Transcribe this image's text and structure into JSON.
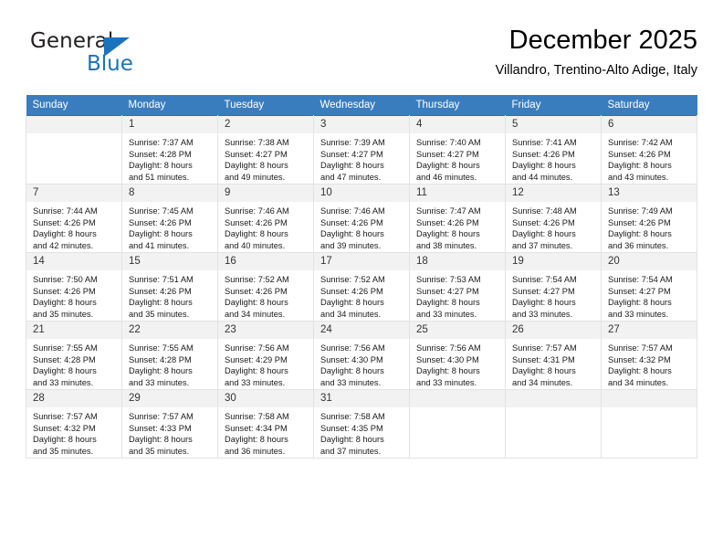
{
  "brand": {
    "name_part1": "General",
    "name_part2": "Blue",
    "triangle_color": "#1c72bb"
  },
  "header": {
    "title": "December 2025",
    "subtitle": "Villandro, Trentino-Alto Adige, Italy"
  },
  "calendar": {
    "accent_color": "#3a7dbf",
    "weekday_headers": [
      "Sunday",
      "Monday",
      "Tuesday",
      "Wednesday",
      "Thursday",
      "Friday",
      "Saturday"
    ],
    "weeks": [
      [
        {
          "day": "",
          "sunrise": "",
          "sunset": "",
          "daylight_line1": "",
          "daylight_line2": ""
        },
        {
          "day": "1",
          "sunrise": "Sunrise: 7:37 AM",
          "sunset": "Sunset: 4:28 PM",
          "daylight_line1": "Daylight: 8 hours",
          "daylight_line2": "and 51 minutes."
        },
        {
          "day": "2",
          "sunrise": "Sunrise: 7:38 AM",
          "sunset": "Sunset: 4:27 PM",
          "daylight_line1": "Daylight: 8 hours",
          "daylight_line2": "and 49 minutes."
        },
        {
          "day": "3",
          "sunrise": "Sunrise: 7:39 AM",
          "sunset": "Sunset: 4:27 PM",
          "daylight_line1": "Daylight: 8 hours",
          "daylight_line2": "and 47 minutes."
        },
        {
          "day": "4",
          "sunrise": "Sunrise: 7:40 AM",
          "sunset": "Sunset: 4:27 PM",
          "daylight_line1": "Daylight: 8 hours",
          "daylight_line2": "and 46 minutes."
        },
        {
          "day": "5",
          "sunrise": "Sunrise: 7:41 AM",
          "sunset": "Sunset: 4:26 PM",
          "daylight_line1": "Daylight: 8 hours",
          "daylight_line2": "and 44 minutes."
        },
        {
          "day": "6",
          "sunrise": "Sunrise: 7:42 AM",
          "sunset": "Sunset: 4:26 PM",
          "daylight_line1": "Daylight: 8 hours",
          "daylight_line2": "and 43 minutes."
        }
      ],
      [
        {
          "day": "7",
          "sunrise": "Sunrise: 7:44 AM",
          "sunset": "Sunset: 4:26 PM",
          "daylight_line1": "Daylight: 8 hours",
          "daylight_line2": "and 42 minutes."
        },
        {
          "day": "8",
          "sunrise": "Sunrise: 7:45 AM",
          "sunset": "Sunset: 4:26 PM",
          "daylight_line1": "Daylight: 8 hours",
          "daylight_line2": "and 41 minutes."
        },
        {
          "day": "9",
          "sunrise": "Sunrise: 7:46 AM",
          "sunset": "Sunset: 4:26 PM",
          "daylight_line1": "Daylight: 8 hours",
          "daylight_line2": "and 40 minutes."
        },
        {
          "day": "10",
          "sunrise": "Sunrise: 7:46 AM",
          "sunset": "Sunset: 4:26 PM",
          "daylight_line1": "Daylight: 8 hours",
          "daylight_line2": "and 39 minutes."
        },
        {
          "day": "11",
          "sunrise": "Sunrise: 7:47 AM",
          "sunset": "Sunset: 4:26 PM",
          "daylight_line1": "Daylight: 8 hours",
          "daylight_line2": "and 38 minutes."
        },
        {
          "day": "12",
          "sunrise": "Sunrise: 7:48 AM",
          "sunset": "Sunset: 4:26 PM",
          "daylight_line1": "Daylight: 8 hours",
          "daylight_line2": "and 37 minutes."
        },
        {
          "day": "13",
          "sunrise": "Sunrise: 7:49 AM",
          "sunset": "Sunset: 4:26 PM",
          "daylight_line1": "Daylight: 8 hours",
          "daylight_line2": "and 36 minutes."
        }
      ],
      [
        {
          "day": "14",
          "sunrise": "Sunrise: 7:50 AM",
          "sunset": "Sunset: 4:26 PM",
          "daylight_line1": "Daylight: 8 hours",
          "daylight_line2": "and 35 minutes."
        },
        {
          "day": "15",
          "sunrise": "Sunrise: 7:51 AM",
          "sunset": "Sunset: 4:26 PM",
          "daylight_line1": "Daylight: 8 hours",
          "daylight_line2": "and 35 minutes."
        },
        {
          "day": "16",
          "sunrise": "Sunrise: 7:52 AM",
          "sunset": "Sunset: 4:26 PM",
          "daylight_line1": "Daylight: 8 hours",
          "daylight_line2": "and 34 minutes."
        },
        {
          "day": "17",
          "sunrise": "Sunrise: 7:52 AM",
          "sunset": "Sunset: 4:26 PM",
          "daylight_line1": "Daylight: 8 hours",
          "daylight_line2": "and 34 minutes."
        },
        {
          "day": "18",
          "sunrise": "Sunrise: 7:53 AM",
          "sunset": "Sunset: 4:27 PM",
          "daylight_line1": "Daylight: 8 hours",
          "daylight_line2": "and 33 minutes."
        },
        {
          "day": "19",
          "sunrise": "Sunrise: 7:54 AM",
          "sunset": "Sunset: 4:27 PM",
          "daylight_line1": "Daylight: 8 hours",
          "daylight_line2": "and 33 minutes."
        },
        {
          "day": "20",
          "sunrise": "Sunrise: 7:54 AM",
          "sunset": "Sunset: 4:27 PM",
          "daylight_line1": "Daylight: 8 hours",
          "daylight_line2": "and 33 minutes."
        }
      ],
      [
        {
          "day": "21",
          "sunrise": "Sunrise: 7:55 AM",
          "sunset": "Sunset: 4:28 PM",
          "daylight_line1": "Daylight: 8 hours",
          "daylight_line2": "and 33 minutes."
        },
        {
          "day": "22",
          "sunrise": "Sunrise: 7:55 AM",
          "sunset": "Sunset: 4:28 PM",
          "daylight_line1": "Daylight: 8 hours",
          "daylight_line2": "and 33 minutes."
        },
        {
          "day": "23",
          "sunrise": "Sunrise: 7:56 AM",
          "sunset": "Sunset: 4:29 PM",
          "daylight_line1": "Daylight: 8 hours",
          "daylight_line2": "and 33 minutes."
        },
        {
          "day": "24",
          "sunrise": "Sunrise: 7:56 AM",
          "sunset": "Sunset: 4:30 PM",
          "daylight_line1": "Daylight: 8 hours",
          "daylight_line2": "and 33 minutes."
        },
        {
          "day": "25",
          "sunrise": "Sunrise: 7:56 AM",
          "sunset": "Sunset: 4:30 PM",
          "daylight_line1": "Daylight: 8 hours",
          "daylight_line2": "and 33 minutes."
        },
        {
          "day": "26",
          "sunrise": "Sunrise: 7:57 AM",
          "sunset": "Sunset: 4:31 PM",
          "daylight_line1": "Daylight: 8 hours",
          "daylight_line2": "and 34 minutes."
        },
        {
          "day": "27",
          "sunrise": "Sunrise: 7:57 AM",
          "sunset": "Sunset: 4:32 PM",
          "daylight_line1": "Daylight: 8 hours",
          "daylight_line2": "and 34 minutes."
        }
      ],
      [
        {
          "day": "28",
          "sunrise": "Sunrise: 7:57 AM",
          "sunset": "Sunset: 4:32 PM",
          "daylight_line1": "Daylight: 8 hours",
          "daylight_line2": "and 35 minutes."
        },
        {
          "day": "29",
          "sunrise": "Sunrise: 7:57 AM",
          "sunset": "Sunset: 4:33 PM",
          "daylight_line1": "Daylight: 8 hours",
          "daylight_line2": "and 35 minutes."
        },
        {
          "day": "30",
          "sunrise": "Sunrise: 7:58 AM",
          "sunset": "Sunset: 4:34 PM",
          "daylight_line1": "Daylight: 8 hours",
          "daylight_line2": "and 36 minutes."
        },
        {
          "day": "31",
          "sunrise": "Sunrise: 7:58 AM",
          "sunset": "Sunset: 4:35 PM",
          "daylight_line1": "Daylight: 8 hours",
          "daylight_line2": "and 37 minutes."
        },
        {
          "day": "",
          "sunrise": "",
          "sunset": "",
          "daylight_line1": "",
          "daylight_line2": ""
        },
        {
          "day": "",
          "sunrise": "",
          "sunset": "",
          "daylight_line1": "",
          "daylight_line2": ""
        },
        {
          "day": "",
          "sunrise": "",
          "sunset": "",
          "daylight_line1": "",
          "daylight_line2": ""
        }
      ]
    ]
  }
}
